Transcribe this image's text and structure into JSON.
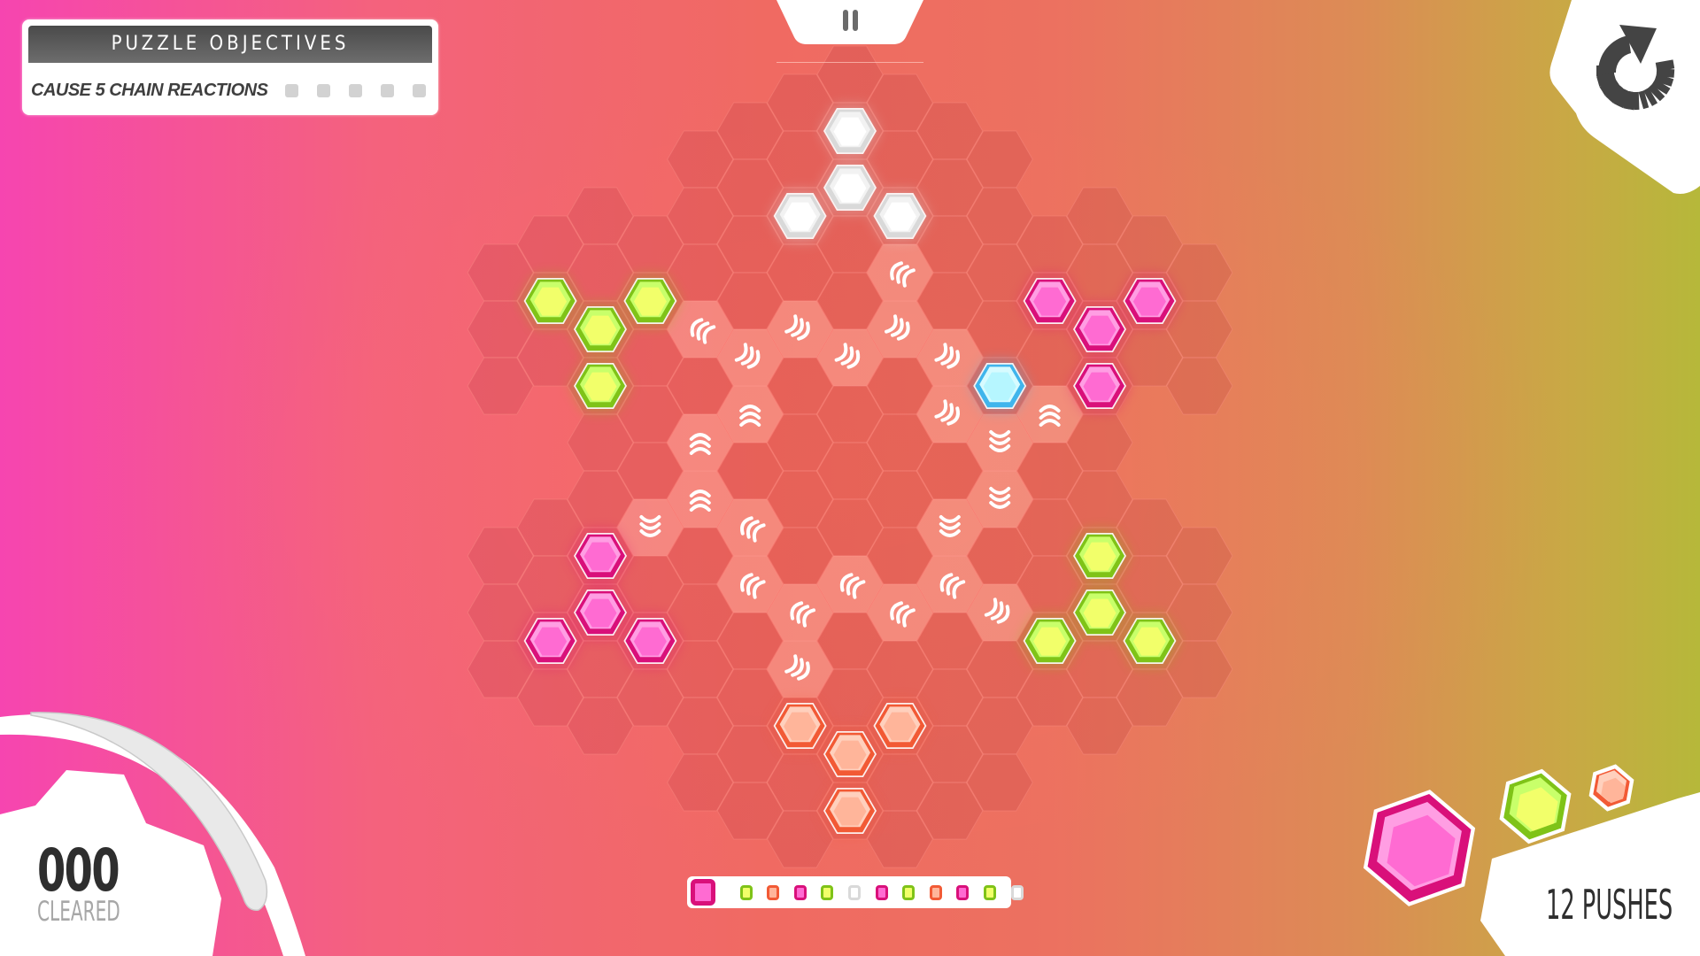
{
  "objectives": {
    "title": "PUZZLE OBJECTIVES",
    "text": "CAUSE 5 CHAIN REACTIONS",
    "required": 5,
    "completed": 0
  },
  "hud": {
    "pause_icon": "pause-icon",
    "restart_icon": "restart-icon",
    "cleared_value": "000",
    "cleared_label": "CLEARED",
    "pushes_label": "12 PUSHES",
    "pushes": 12
  },
  "colors": {
    "pink": {
      "outer": "#d9107a",
      "inner": "#ff6bd2",
      "hi": "#ff9ee3"
    },
    "lime": {
      "outer": "#7fc318",
      "inner": "#f2ff6a",
      "hi": "#c8ff6a"
    },
    "orange": {
      "outer": "#f25a35",
      "inner": "#ffb59a",
      "hi": "#ffd0bd"
    },
    "white": {
      "outer": "#d9d9d9",
      "inner": "#ffffff",
      "hi": "#f2f2f2"
    },
    "cyan": {
      "outer": "#40b5ec",
      "inner": "#b6f6ff",
      "hi": "#d7fbff"
    }
  },
  "next_pieces": [
    "pink",
    "lime",
    "orange"
  ],
  "queue": [
    "pink",
    "lime",
    "orange",
    "pink",
    "lime",
    "white",
    "pink",
    "lime",
    "orange",
    "pink",
    "lime",
    "white"
  ],
  "queue_selected": 0,
  "board": {
    "columns": {
      "-7": [
        7,
        9,
        11,
        17,
        19,
        21
      ],
      "-6": [
        6,
        8,
        10,
        16,
        18,
        20,
        22
      ],
      "-5": [
        5,
        7,
        9,
        11,
        13,
        15,
        17,
        19,
        21,
        23
      ],
      "-4": [
        6,
        8,
        10,
        12,
        14,
        16,
        18,
        20,
        22
      ],
      "-3": [
        3,
        5,
        7,
        9,
        11,
        13,
        15,
        17,
        19,
        21,
        23,
        25
      ],
      "-2": [
        2,
        4,
        6,
        8,
        10,
        12,
        14,
        16,
        18,
        20,
        22,
        24,
        26
      ],
      "-1": [
        1,
        3,
        5,
        7,
        9,
        11,
        13,
        15,
        17,
        19,
        21,
        23,
        25,
        27
      ],
      "0": [
        0,
        2,
        4,
        6,
        8,
        10,
        12,
        14,
        16,
        18,
        20,
        22,
        24,
        26
      ],
      "1": [
        1,
        3,
        5,
        7,
        9,
        11,
        13,
        15,
        17,
        19,
        21,
        23,
        25,
        27
      ],
      "2": [
        2,
        4,
        6,
        8,
        10,
        12,
        14,
        16,
        18,
        20,
        22,
        24,
        26
      ],
      "3": [
        3,
        5,
        7,
        9,
        11,
        13,
        15,
        17,
        19,
        21,
        23,
        25
      ],
      "4": [
        6,
        8,
        10,
        12,
        14,
        16,
        18,
        20,
        22
      ],
      "5": [
        5,
        7,
        9,
        11,
        13,
        15,
        17,
        19,
        21,
        23
      ],
      "6": [
        6,
        8,
        10,
        16,
        18,
        20,
        22
      ],
      "7": [
        7,
        9,
        11,
        17,
        19,
        21
      ]
    },
    "pieces": [
      {
        "c": 0,
        "h": 2,
        "color": "white"
      },
      {
        "c": 0,
        "h": 4,
        "color": "white"
      },
      {
        "c": -1,
        "h": 5,
        "color": "white"
      },
      {
        "c": 1,
        "h": 5,
        "color": "white"
      },
      {
        "c": -6,
        "h": 8,
        "color": "lime"
      },
      {
        "c": -5,
        "h": 9,
        "color": "lime"
      },
      {
        "c": -4,
        "h": 8,
        "color": "lime"
      },
      {
        "c": -5,
        "h": 11,
        "color": "lime"
      },
      {
        "c": 4,
        "h": 8,
        "color": "pink"
      },
      {
        "c": 5,
        "h": 9,
        "color": "pink"
      },
      {
        "c": 6,
        "h": 8,
        "color": "pink"
      },
      {
        "c": 5,
        "h": 11,
        "color": "pink"
      },
      {
        "c": 3,
        "h": 11,
        "color": "cyan"
      },
      {
        "c": -5,
        "h": 17,
        "color": "pink"
      },
      {
        "c": -5,
        "h": 19,
        "color": "pink"
      },
      {
        "c": -6,
        "h": 20,
        "color": "pink"
      },
      {
        "c": -4,
        "h": 20,
        "color": "pink"
      },
      {
        "c": 5,
        "h": 17,
        "color": "lime"
      },
      {
        "c": 5,
        "h": 19,
        "color": "lime"
      },
      {
        "c": 4,
        "h": 20,
        "color": "lime"
      },
      {
        "c": 6,
        "h": 20,
        "color": "lime"
      },
      {
        "c": -1,
        "h": 23,
        "color": "orange"
      },
      {
        "c": 1,
        "h": 23,
        "color": "orange"
      },
      {
        "c": 0,
        "h": 24,
        "color": "orange"
      },
      {
        "c": 0,
        "h": 26,
        "color": "orange"
      }
    ],
    "arrows": [
      {
        "c": 1,
        "h": 7,
        "dir": "ul"
      },
      {
        "c": -3,
        "h": 9,
        "dir": "ul"
      },
      {
        "c": -2,
        "h": 10,
        "dir": "dr"
      },
      {
        "c": -1,
        "h": 9,
        "dir": "dr"
      },
      {
        "c": 0,
        "h": 10,
        "dir": "dr"
      },
      {
        "c": 1,
        "h": 9,
        "dir": "dr"
      },
      {
        "c": 2,
        "h": 10,
        "dir": "dr"
      },
      {
        "c": 2,
        "h": 12,
        "dir": "dr"
      },
      {
        "c": 4,
        "h": 12,
        "dir": "u"
      },
      {
        "c": 3,
        "h": 13,
        "dir": "d"
      },
      {
        "c": 3,
        "h": 15,
        "dir": "d"
      },
      {
        "c": 2,
        "h": 16,
        "dir": "d"
      },
      {
        "c": -2,
        "h": 12,
        "dir": "u"
      },
      {
        "c": -3,
        "h": 13,
        "dir": "u"
      },
      {
        "c": -3,
        "h": 15,
        "dir": "u"
      },
      {
        "c": -4,
        "h": 16,
        "dir": "d"
      },
      {
        "c": -2,
        "h": 16,
        "dir": "ul"
      },
      {
        "c": -2,
        "h": 18,
        "dir": "ul"
      },
      {
        "c": -1,
        "h": 19,
        "dir": "ul"
      },
      {
        "c": 0,
        "h": 18,
        "dir": "ul"
      },
      {
        "c": 1,
        "h": 19,
        "dir": "ul"
      },
      {
        "c": 2,
        "h": 18,
        "dir": "ul"
      },
      {
        "c": 3,
        "h": 19,
        "dir": "dr"
      },
      {
        "c": -1,
        "h": 21,
        "dir": "dr"
      }
    ]
  }
}
